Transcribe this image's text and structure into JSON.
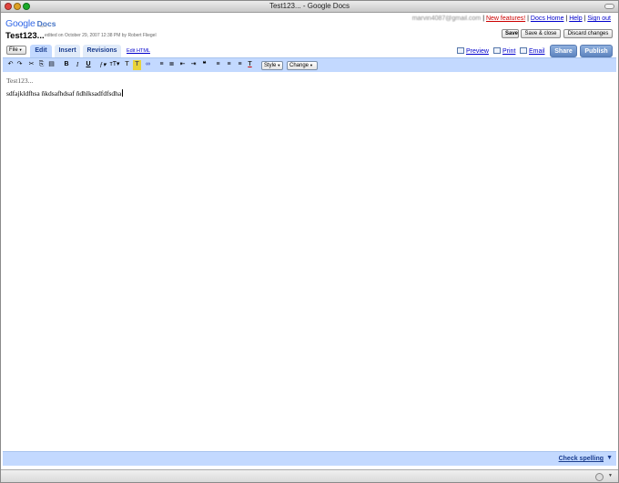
{
  "window": {
    "title": "Test123... - Google Docs"
  },
  "header": {
    "logo_google": "Google",
    "logo_docs": "Docs",
    "logo_beta": "BETA",
    "user_email": "marvin4087@gmail.com",
    "sep1": " | ",
    "link_new_features": "New features!",
    "sep2": " | ",
    "link_docs_home": "Docs Home",
    "sep3": " | ",
    "link_help": "Help",
    "sep4": " | ",
    "link_sign_out": "Sign out"
  },
  "doc": {
    "title": "Test123...",
    "meta": "edited on October 29, 2007 12:38 PM by Robert Fliegel"
  },
  "actions": {
    "save": "Save",
    "save_close": "Save & close",
    "discard": "Discard changes"
  },
  "tabs": {
    "file": "File",
    "edit": "Edit",
    "insert": "Insert",
    "revisions": "Revisions",
    "edit_html": "Edit HTML"
  },
  "right_links": {
    "preview": "Preview",
    "print": "Print",
    "email": "Email",
    "share": "Share",
    "publish": "Publish"
  },
  "toolbar": {
    "undo": "↶",
    "redo": "↷",
    "cut": "✂",
    "copy": "⎘",
    "paste": "▤",
    "bold": "B",
    "italic": "I",
    "underline": "U",
    "font": "ƒ▾",
    "size": "ᴛT▾",
    "text_color": "T",
    "highlight": "T",
    "link": "∞",
    "numbered_list": "≡",
    "bullet_list": "≣",
    "outdent": "⇤",
    "indent": "⇥",
    "quote": "❝",
    "align_left": "≡",
    "align_center": "≡",
    "align_right": "≡",
    "clear_format": "T",
    "style": "Style",
    "change": "Change"
  },
  "editor": {
    "title_line": "Test123...",
    "body_text": "sdfajkldfhsa ñkdsafhdsaf ñdhlksadfdfsdha"
  },
  "bottom": {
    "check_spelling": "Check spelling"
  },
  "colors": {
    "toolbar_bg": "#c3d9ff",
    "tab_active": "#c3d9ff",
    "link": "#0000cc",
    "new_features": "#cc0000",
    "share_button": "#5d84bf"
  }
}
